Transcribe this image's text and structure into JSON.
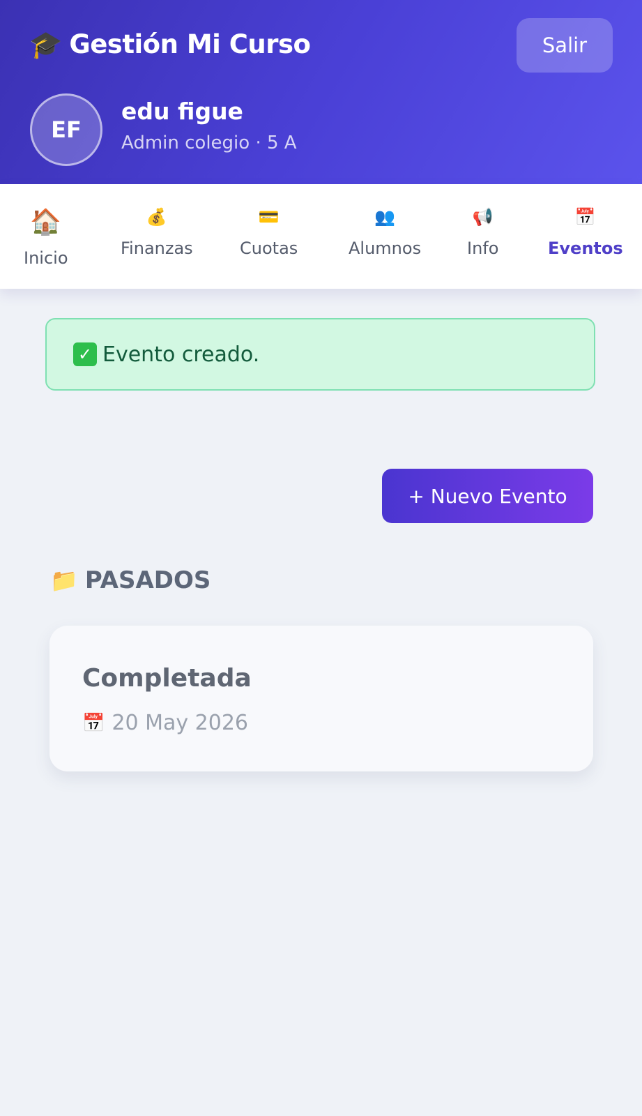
{
  "header": {
    "brand_icon": "🎓",
    "title": "Gestión Mi Curso",
    "logout_label": "Salir",
    "avatar_initials": "EF",
    "user_name": "edu figue",
    "user_role": "Admin colegio · 5 A"
  },
  "tabs": [
    {
      "label": "Inicio",
      "icon": "🏠",
      "icon_name": "house-icon"
    },
    {
      "label": "Finanzas",
      "icon": "💰",
      "icon_name": "money-bag-icon"
    },
    {
      "label": "Cuotas",
      "icon": "💳",
      "icon_name": "credit-card-icon"
    },
    {
      "label": "Alumnos",
      "icon": "👥",
      "icon_name": "people-icon"
    },
    {
      "label": "Info",
      "icon": "📢",
      "icon_name": "megaphone-icon"
    },
    {
      "label": "Eventos",
      "icon": "📅",
      "icon_name": "calendar-icon"
    }
  ],
  "active_tab": "Eventos",
  "alert": {
    "icon": "✓",
    "icon_name": "check-box-icon",
    "text": "Evento creado."
  },
  "actions": {
    "new_event_label": "+ Nuevo Evento"
  },
  "past_section": {
    "icon": "📁",
    "icon_name": "folder-icon",
    "title": "PASADOS"
  },
  "events": [
    {
      "title": "Completada",
      "date_icon": "📅",
      "date": "20 May 2026"
    }
  ],
  "colors": {
    "header_start": "#3b31b3",
    "header_end": "#5b53ec",
    "active_tab": "#4f3fc8",
    "alert_bg": "#d2f8e2",
    "alert_border": "#7fe0b2",
    "alert_text": "#135b3c",
    "button_start": "#4a35d0",
    "button_end": "#7b3be8",
    "page_bg": "#eff2f7"
  }
}
